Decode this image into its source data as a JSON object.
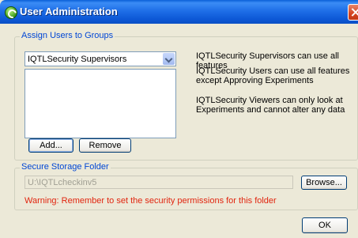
{
  "window": {
    "title": "User Administration"
  },
  "assign_group": {
    "legend": "Assign Users to Groups",
    "selected_group": "IQTLSecurity Supervisors",
    "add_label": "Add...",
    "remove_label": "Remove",
    "descriptions": [
      "IQTLSecurity Supervisors can use all features",
      "IQTLSecurity Users can use all features except Approving Experiments",
      "IQTLSecurity Viewers can only look at Experiments and cannot alter any data"
    ]
  },
  "storage_group": {
    "legend": "Secure Storage Folder",
    "folder_path": "U:\\IQTLcheckinv5",
    "browse_label": "Browse...",
    "warning": "Warning: Remember to set the security permissions for this folder"
  },
  "footer": {
    "ok_label": "OK"
  },
  "colors": {
    "legend": "#0046d5",
    "warning": "#e1250f",
    "titlebar": "#0a5fd8"
  }
}
